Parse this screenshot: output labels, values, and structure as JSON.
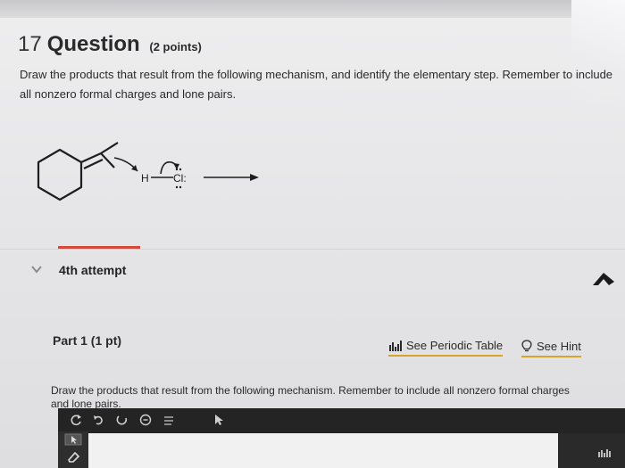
{
  "question": {
    "number": "17",
    "word": "Question",
    "points": "(2 points)",
    "prompt": "Draw the products that result from the following mechanism, and identify the elementary step. Remember to include all nonzero formal charges and lone pairs."
  },
  "mechanism": {
    "hydrogen": "H",
    "chlorine": "Cl:"
  },
  "attempt": {
    "label": "4th attempt"
  },
  "part": {
    "label": "Part 1 (1 pt)",
    "periodic_table": "See Periodic Table",
    "hint": "See Hint",
    "prompt": "Draw the products that result from the following mechanism. Remember to include all nonzero formal charges and lone pairs."
  },
  "editor": {
    "tools": [
      "undo-icon",
      "redo-icon",
      "reset-icon",
      "zoom-icon",
      "template-icon",
      "select-icon"
    ],
    "sidebar_tools": [
      "pointer-icon",
      "eraser-icon"
    ]
  },
  "colors": {
    "divider_red": "#d24a3a",
    "link_underline": "#d8a42a",
    "editor_dark": "#242424"
  }
}
